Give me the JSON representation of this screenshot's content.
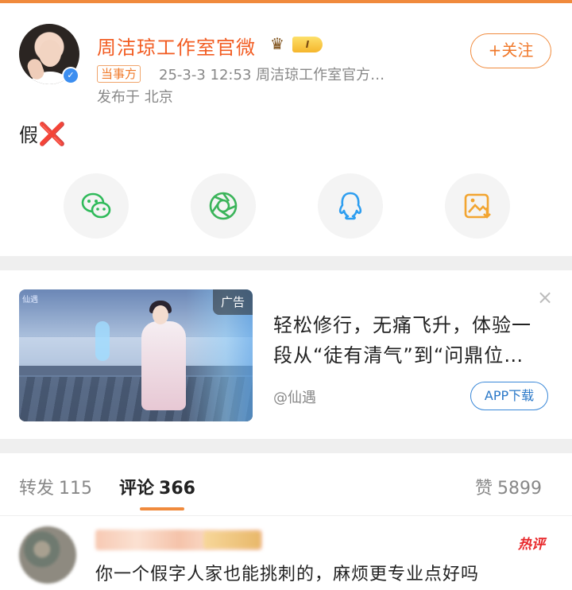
{
  "post": {
    "author_name": "周洁琼工作室官微",
    "vip_level": "I",
    "follow_label": "+关注",
    "tag_label": "当事方",
    "meta": "25-3-3 12:53  周洁琼工作室官方…",
    "location": "发布于 北京",
    "text": "假",
    "text_mark": "❌"
  },
  "share": {
    "buttons": [
      "wechat",
      "moments",
      "qq",
      "save-image"
    ]
  },
  "ad": {
    "label": "广告",
    "close": "×",
    "text": "轻松修行，无痛飞升，体验一段从“徒有清气”到“问鼎位…",
    "source": "@仙遇",
    "app_button": "APP下载",
    "image_logo": "仙遇"
  },
  "tabs": [
    {
      "label": "转发",
      "count": "115"
    },
    {
      "label": "评论",
      "count": "366"
    },
    {
      "label": "赞",
      "count": "5899"
    }
  ],
  "comments": [
    {
      "badge": "热评",
      "text": "你一个假字人家也能挑刺的，麻烦更专业点好吗"
    }
  ],
  "colors": {
    "brand_orange": "#f08a3c",
    "name_orange": "#f25c22",
    "link_blue": "#2a78c8",
    "hot_red": "#e8282b"
  }
}
